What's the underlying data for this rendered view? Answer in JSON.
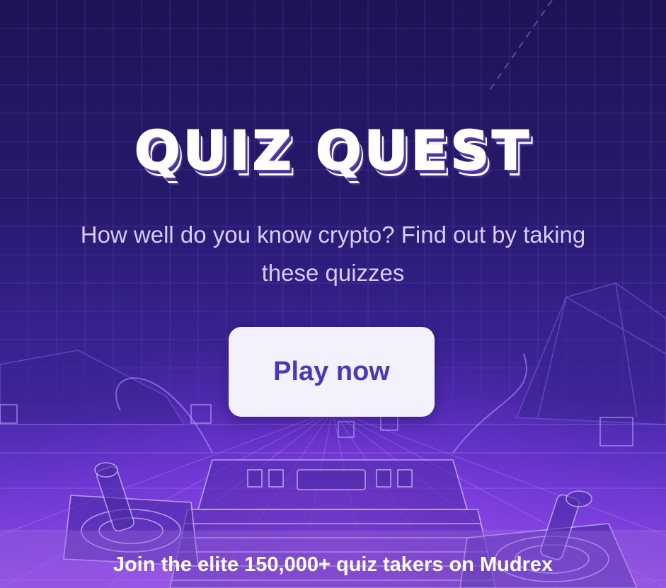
{
  "hero": {
    "title": "QUIZ QUEST",
    "subtitle": "How well do you know crypto? Find out by taking these quizzes"
  },
  "cta": {
    "label": "Play now"
  },
  "footer": {
    "text": "Join the elite 150,000+ quiz takers on Mudrex"
  },
  "colors": {
    "background": "#271a6e",
    "accent_glow": "#d650ff",
    "button_bg": "#f3f1fb",
    "button_text": "#4b36c2",
    "subtitle_text": "#d6cdfb"
  },
  "icons": {
    "background_art": "retro-arcade-console-icon",
    "left_joystick": "joystick-icon",
    "right_joystick": "joystick-icon"
  }
}
